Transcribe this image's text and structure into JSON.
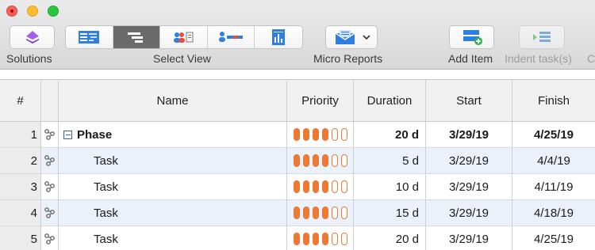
{
  "toolbar": {
    "solutions_label": "Solutions",
    "select_view_label": "Select View",
    "micro_reports_label": "Micro Reports",
    "add_item_label": "Add Item",
    "indent_label": "Indent task(s)",
    "overflow_label": "C"
  },
  "grid": {
    "headers": {
      "num": "#",
      "name": "Name",
      "priority": "Priority",
      "duration": "Duration",
      "start": "Start",
      "finish": "Finish"
    },
    "rows": [
      {
        "num": "1",
        "name": "Phase",
        "priority": 4,
        "duration": "20 d",
        "start": "3/29/19",
        "finish": "4/25/19"
      },
      {
        "num": "2",
        "name": "Task",
        "priority": 4,
        "duration": "5 d",
        "start": "3/29/19",
        "finish": "4/4/19"
      },
      {
        "num": "3",
        "name": "Task",
        "priority": 4,
        "duration": "10 d",
        "start": "3/29/19",
        "finish": "4/11/19"
      },
      {
        "num": "4",
        "name": "Task",
        "priority": 4,
        "duration": "15 d",
        "start": "3/29/19",
        "finish": "4/18/19"
      },
      {
        "num": "5",
        "name": "Task",
        "priority": 4,
        "duration": "20 d",
        "start": "3/29/19",
        "finish": "4/25/19"
      }
    ],
    "priority_max": 6
  },
  "colors": {
    "priority_accent": "#ec7a35",
    "selected_segment": "#6a6a6b",
    "alt_row": "#ebf1fb",
    "icon_blue": "#2f7fe0",
    "solutions_purple": "#8a3fd1"
  },
  "icons": {
    "solutions": "diamond-stack-icon",
    "view_1": "gantt-table-icon",
    "view_2": "gantt-bars-icon",
    "view_3": "resource-people-icon",
    "view_4": "resource-usage-icon",
    "view_5": "report-chart-icon",
    "micro_reports": "envelope-report-icon",
    "add_item": "add-row-icon",
    "indent": "indent-icon",
    "row_link": "link-chain-icon"
  }
}
